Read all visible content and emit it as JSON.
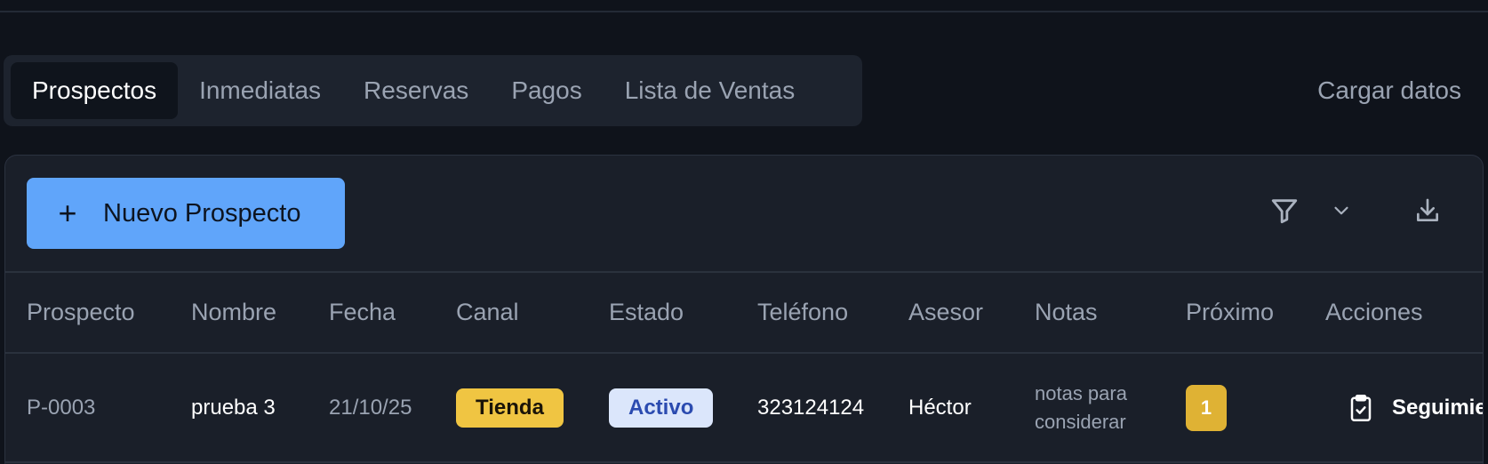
{
  "tabs": [
    {
      "label": "Prospectos",
      "active": true
    },
    {
      "label": "Inmediatas",
      "active": false
    },
    {
      "label": "Reservas",
      "active": false
    },
    {
      "label": "Pagos",
      "active": false
    },
    {
      "label": "Lista de Ventas",
      "active": false
    }
  ],
  "load_data_label": "Cargar datos",
  "toolbar": {
    "new_button_label": "Nuevo Prospecto",
    "icons": [
      "plus-icon",
      "filter-icon",
      "chevron-down-icon",
      "download-icon"
    ]
  },
  "table": {
    "columns": [
      "Prospecto",
      "Nombre",
      "Fecha",
      "Canal",
      "Estado",
      "Teléfono",
      "Asesor",
      "Notas",
      "Próximo",
      "Acciones"
    ],
    "rows": [
      {
        "prospecto": "P-0003",
        "nombre": "prueba 3",
        "fecha": "21/10/25",
        "canal": "Tienda",
        "estado": "Activo",
        "telefono": "323124124",
        "asesor": "Héctor",
        "notas": "notas para considerar",
        "proximo": "1",
        "accion": "Seguimiento",
        "accion_icon": "clipboard-check-icon"
      }
    ]
  },
  "colors": {
    "background": "#0f131b",
    "card": "#1a1f29",
    "primary": "#60a5fa",
    "canal_badge": "#f0c542",
    "estado_badge": "#dbe6fb",
    "proximo_badge": "#dfb234"
  }
}
